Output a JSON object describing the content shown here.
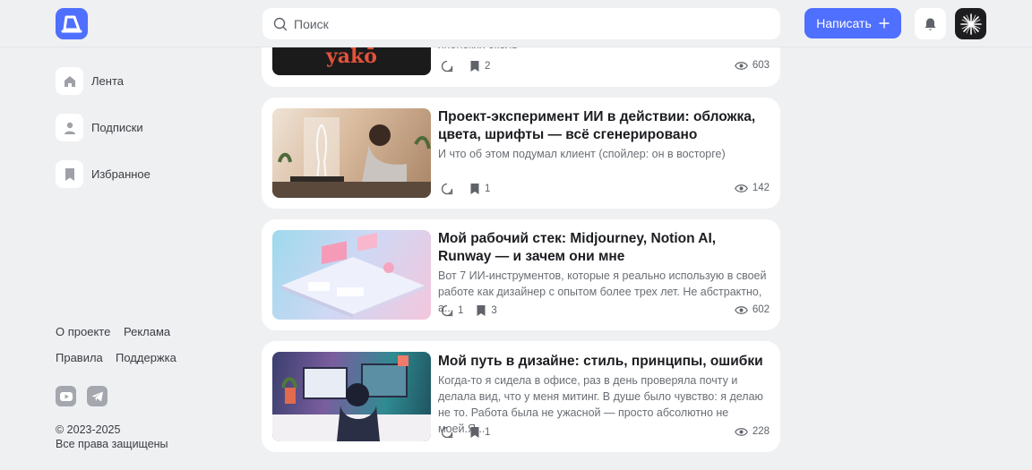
{
  "header": {
    "search_placeholder": "Поиск",
    "write_button": "Написать",
    "accent_color": "#4f6fff"
  },
  "sidebar": {
    "items": [
      {
        "label": "Лента",
        "icon": "home-icon"
      },
      {
        "label": "Подписки",
        "icon": "user-icon"
      },
      {
        "label": "Избранное",
        "icon": "bookmark-icon"
      }
    ],
    "links": [
      "О проекте",
      "Реклама",
      "Правила",
      "Поддержка"
    ],
    "socials": [
      "youtube-icon",
      "telegram-icon"
    ],
    "copyright_years": "© 2023-2025",
    "copyright_text": "Все права защищены"
  },
  "feed": {
    "posts": [
      {
        "title": "",
        "desc": "японских околь",
        "thumb_text": "yakō",
        "comments": "",
        "bookmarks": "2",
        "views": "603"
      },
      {
        "title": "Проект-эксперимент ИИ в действии: обложка, цвета, шрифты — всё сгенерировано",
        "desc": "И что об этом подумал клиент (спойлер: он в восторге)",
        "comments": "",
        "bookmarks": "1",
        "views": "142"
      },
      {
        "title": "Мой рабочий стек: Midjourney, Notion AI, Runway — и зачем они мне",
        "desc": "Вот 7 ИИ-инструментов, которые я реально использую в своей работе как дизайнер с опытом более трех лет. Не абстрактно, а...",
        "comments": "1",
        "bookmarks": "3",
        "views": "602"
      },
      {
        "title": "Мой путь в дизайне: стиль, принципы, ошибки",
        "desc": "Когда-то я сидела в офисе, раз в день проверяла почту и делала вид, что у меня митинг. В душе было чувство: я делаю не то. Работа была не ужасной — просто абсолютно не моей.Я...",
        "comments": "",
        "bookmarks": "1",
        "views": "228"
      }
    ]
  }
}
